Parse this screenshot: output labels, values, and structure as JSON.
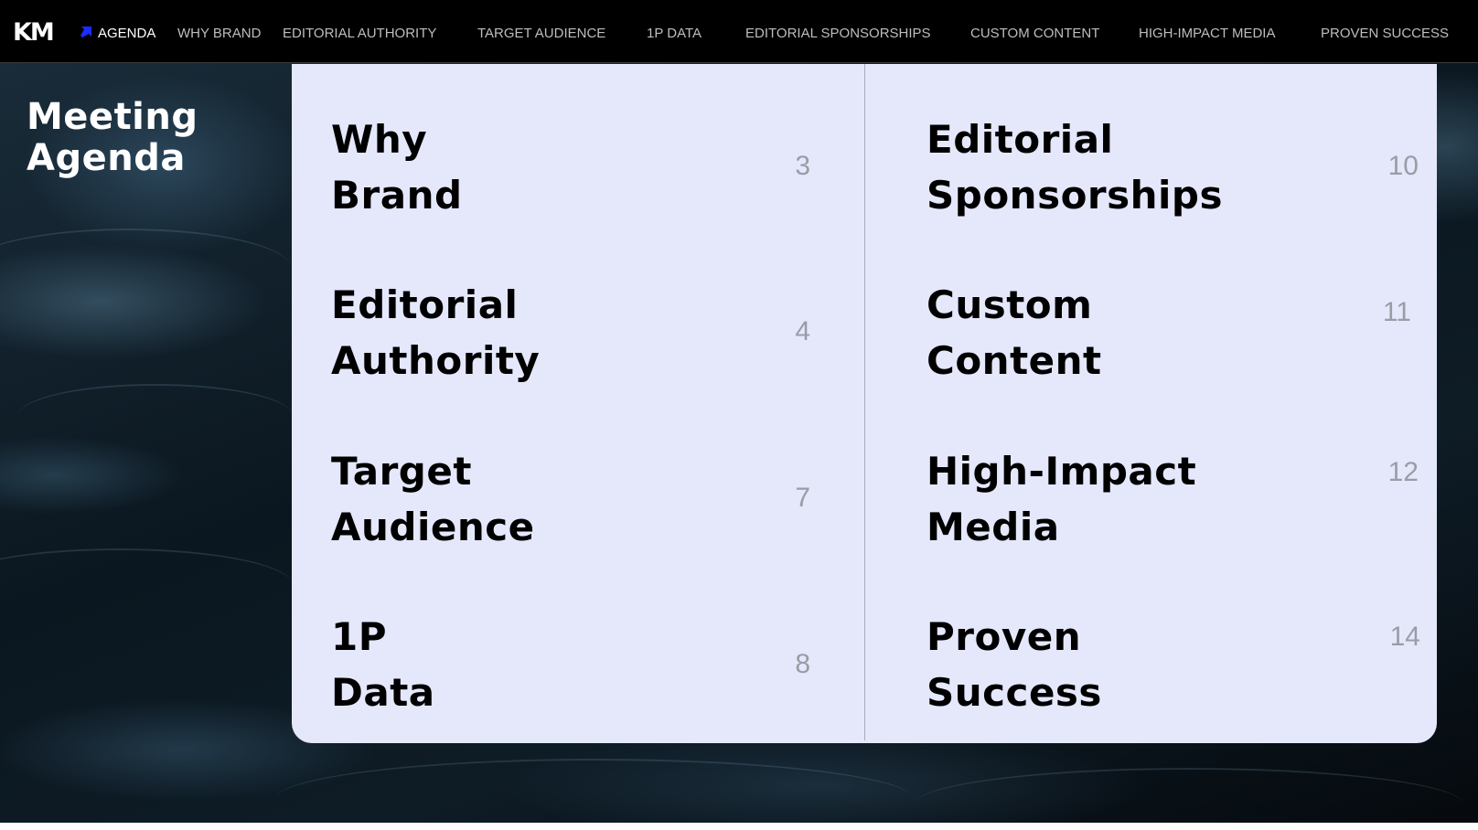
{
  "brand": {
    "logo_text": "KM",
    "accent_color": "#1a2cff"
  },
  "nav": {
    "items": [
      {
        "label": "AGENDA",
        "active": true
      },
      {
        "label": "WHY BRAND"
      },
      {
        "label": "EDITORIAL AUTHORITY"
      },
      {
        "label": "TARGET AUDIENCE"
      },
      {
        "label": "1P DATA"
      },
      {
        "label": "EDITORIAL SPONSORSHIPS"
      },
      {
        "label": "CUSTOM CONTENT"
      },
      {
        "label": "HIGH-IMPACT MEDIA"
      },
      {
        "label": "PROVEN SUCCESS"
      }
    ],
    "active_icon": "arrow-up-right-icon"
  },
  "page": {
    "title_line1": "Meeting",
    "title_line2": "Agenda"
  },
  "agenda": {
    "left": [
      {
        "line1": "Why",
        "line2": "Brand",
        "page": "3"
      },
      {
        "line1": "Editorial",
        "line2": "Authority",
        "page": "4"
      },
      {
        "line1": "Target",
        "line2": "Audience",
        "page": "7"
      },
      {
        "line1": "1P",
        "line2": "Data",
        "page": "8"
      }
    ],
    "right": [
      {
        "line1": "Editorial",
        "line2": "Sponsorships",
        "page": "10"
      },
      {
        "line1": "Custom",
        "line2": "Content",
        "page": "11"
      },
      {
        "line1": "High-Impact",
        "line2": "Media",
        "page": "12"
      },
      {
        "line1": "Proven",
        "line2": "Success",
        "page": "14"
      }
    ]
  },
  "colors": {
    "panel": "#e5e8fb",
    "page_number": "#9a9ca6",
    "nav_bg": "#000000"
  }
}
